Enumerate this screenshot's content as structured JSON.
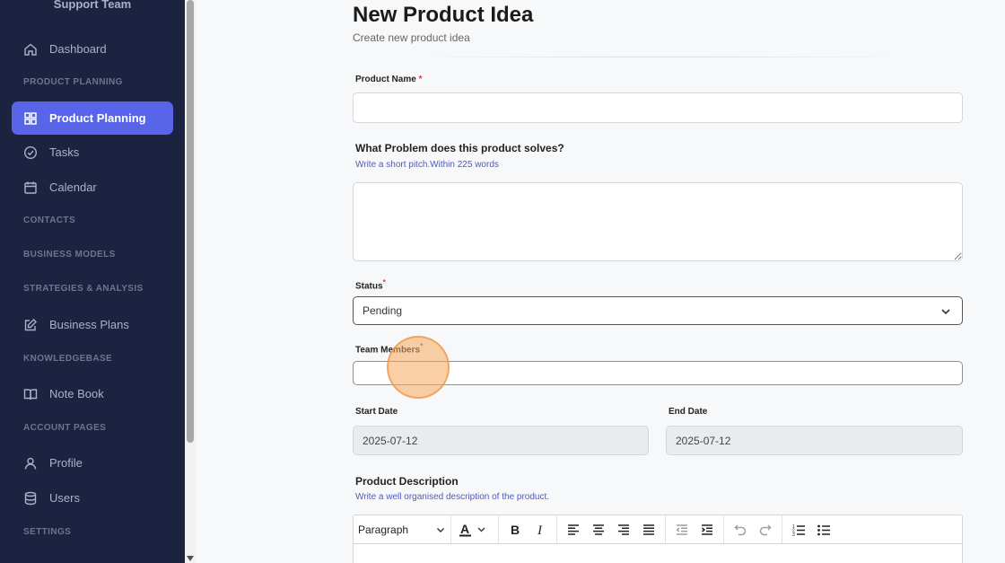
{
  "sidebar": {
    "brand": "Support Team",
    "items": {
      "dashboard": "Dashboard",
      "product_planning": "Product Planning",
      "tasks": "Tasks",
      "calendar": "Calendar",
      "business_plans": "Business Plans",
      "note_book": "Note Book",
      "profile": "Profile",
      "users": "Users"
    },
    "sections": {
      "product_planning": "PRODUCT PLANNING",
      "contacts": "CONTACTS",
      "business_models": "BUSINESS MODELS",
      "strategies": "STRATEGIES & ANALYSIS",
      "knowledgebase": "KNOWLEDGEBASE",
      "account_pages": "ACCOUNT PAGES",
      "settings": "SETTINGS"
    }
  },
  "page": {
    "title": "New Product Idea",
    "subtitle": "Create new product idea"
  },
  "form": {
    "product_name_label": "Product Name",
    "product_name_value": "",
    "problem_label": "What Problem does this product solves?",
    "problem_hint": "Write a short pitch.Within 225 words",
    "problem_value": "",
    "status_label": "Status",
    "status_value": "Pending",
    "team_members_label": "Team Members",
    "team_members_value": "",
    "start_date_label": "Start Date",
    "start_date_value": "2025-07-12",
    "end_date_label": "End Date",
    "end_date_value": "2025-07-12",
    "description_label": "Product Description",
    "description_hint": "Write a well organised description of the product.",
    "required_mark": "*"
  },
  "editor": {
    "paragraph_label": "Paragraph"
  },
  "colors": {
    "sidebar_bg": "#1c2340",
    "accent": "#5865e8",
    "required": "#e0344a",
    "hint": "#4f5bbd"
  }
}
